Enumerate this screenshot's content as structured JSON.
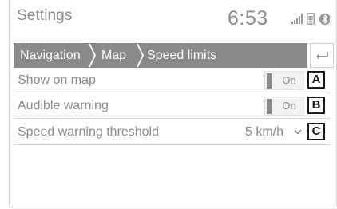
{
  "header": {
    "title": "Settings",
    "clock": "6:53",
    "status_icons": [
      "signal-icon",
      "phone-battery-icon",
      "bluetooth-icon"
    ]
  },
  "breadcrumb": {
    "items": [
      "Navigation",
      "Map",
      "Speed limits"
    ],
    "back_icon": "back-arrow-icon"
  },
  "settings": [
    {
      "label": "Show on map",
      "control": "toggle",
      "value": "On",
      "callout": "A"
    },
    {
      "label": "Audible warning",
      "control": "toggle",
      "value": "On",
      "callout": "B"
    },
    {
      "label": "Speed warning threshold",
      "control": "select",
      "value": "5 km/h",
      "callout": "C"
    }
  ],
  "colors": {
    "text": "#8c8c8c",
    "bar": "#8a8a8a",
    "callout": "#1a1a1a"
  }
}
